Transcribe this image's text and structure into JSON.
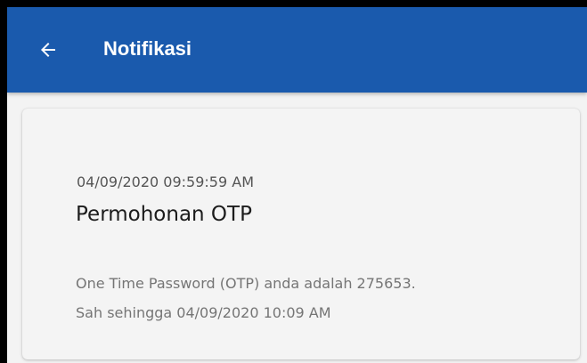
{
  "app_bar": {
    "title": "Notifikasi",
    "back_icon": "arrow-left-icon",
    "background_color": "#1a5aad"
  },
  "notification": {
    "datetime": "04/09/2020 09:59:59 AM",
    "title": "Permohonan OTP",
    "body_line_1": "One Time Password (OTP) anda adalah 275653.",
    "body_line_2": "Sah sehingga 04/09/2020 10:09 AM"
  }
}
